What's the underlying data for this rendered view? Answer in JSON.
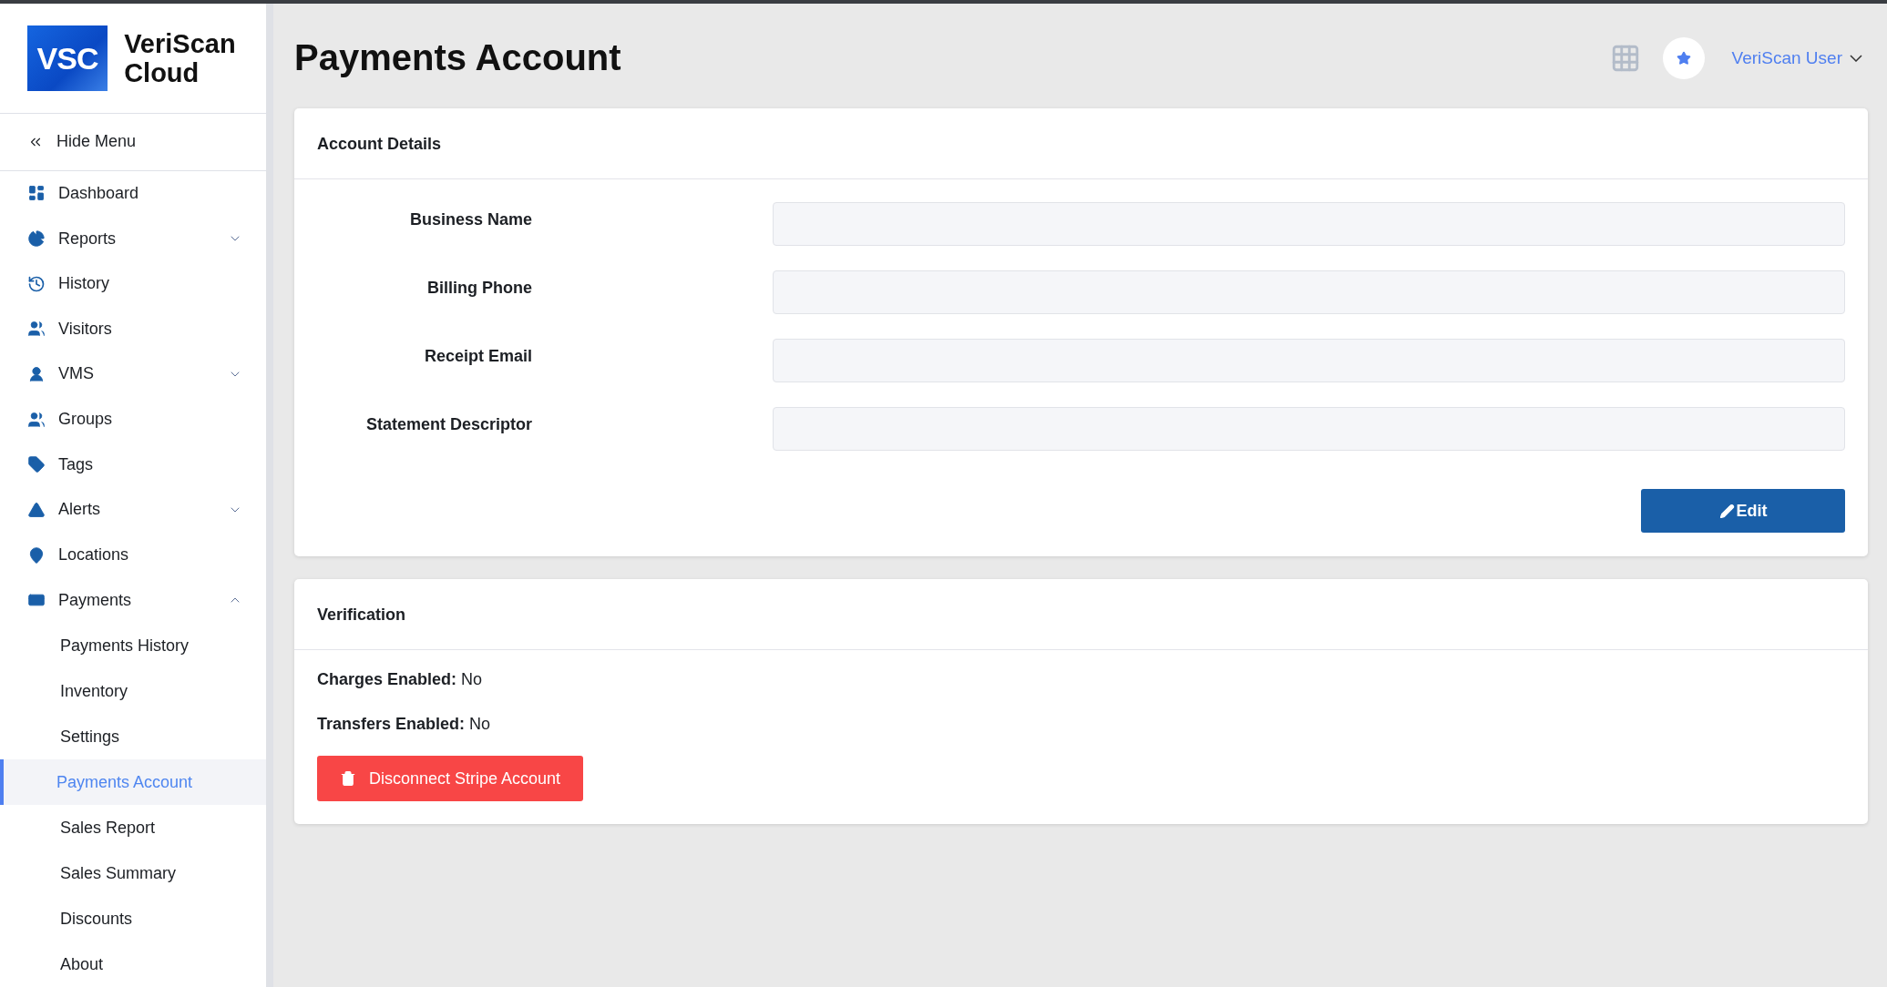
{
  "brand": {
    "logo": "VSC",
    "name": "VeriScan Cloud"
  },
  "hide_menu": "Hide Menu",
  "sidebar": {
    "items": [
      {
        "label": "Dashboard",
        "kind": "link"
      },
      {
        "label": "Reports",
        "kind": "group",
        "expanded": false
      },
      {
        "label": "History",
        "kind": "link"
      },
      {
        "label": "Visitors",
        "kind": "link"
      },
      {
        "label": "VMS",
        "kind": "group",
        "expanded": false
      },
      {
        "label": "Groups",
        "kind": "link"
      },
      {
        "label": "Tags",
        "kind": "link"
      },
      {
        "label": "Alerts",
        "kind": "group",
        "expanded": false
      },
      {
        "label": "Locations",
        "kind": "link"
      },
      {
        "label": "Payments",
        "kind": "group",
        "expanded": true,
        "children": [
          {
            "label": "Payments History",
            "selected": false
          },
          {
            "label": "Inventory",
            "selected": false
          },
          {
            "label": "Settings",
            "selected": false
          },
          {
            "label": "Payments Account",
            "selected": true
          },
          {
            "label": "Sales Report",
            "selected": false
          },
          {
            "label": "Sales Summary",
            "selected": false
          },
          {
            "label": "Discounts",
            "selected": false
          },
          {
            "label": "About",
            "selected": false
          }
        ]
      }
    ]
  },
  "page_title": "Payments Account",
  "user": {
    "name": "VeriScan User"
  },
  "account_details": {
    "title": "Account Details",
    "fields": [
      {
        "label": "Business Name"
      },
      {
        "label": "Billing Phone"
      },
      {
        "label": "Receipt Email"
      },
      {
        "label": "Statement Descriptor"
      }
    ],
    "edit_button": "Edit"
  },
  "verification": {
    "title": "Verification",
    "lines": [
      "**Charges Enabled:** No",
      "**Transfers Enabled:** No"
    ],
    "disconnect_button": "Disconnect Stripe Account"
  }
}
